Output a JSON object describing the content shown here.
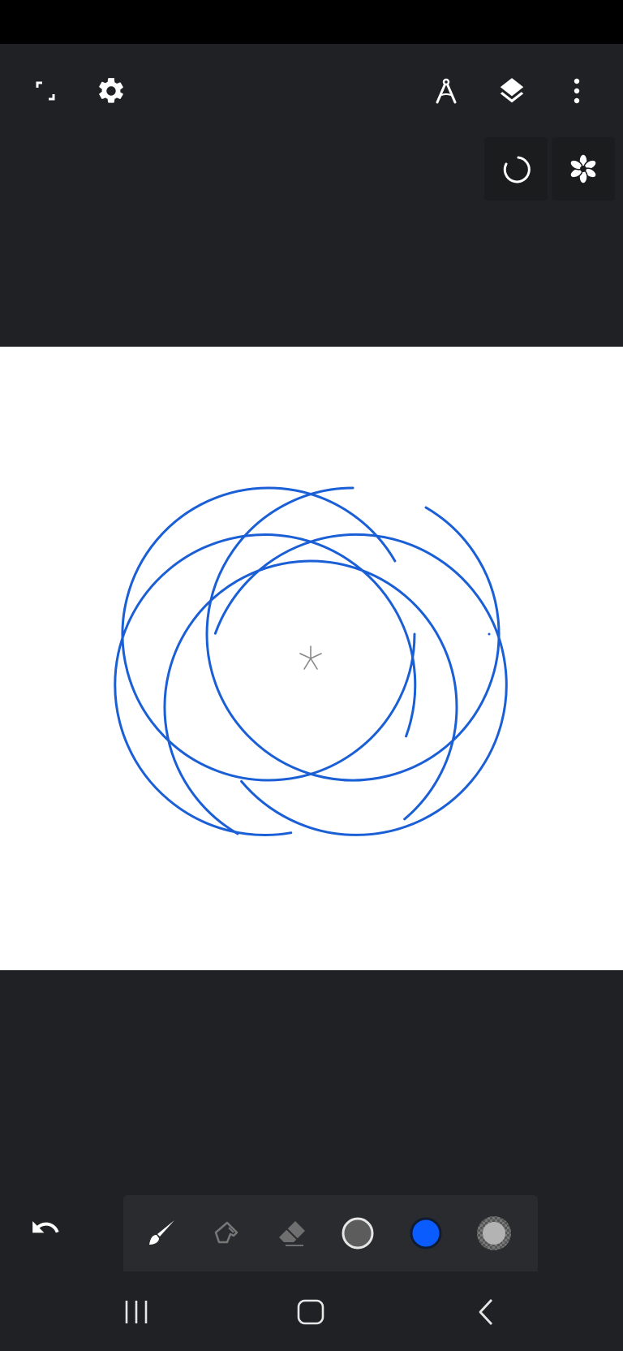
{
  "colors": {
    "background": "#202124",
    "status_bar": "#000000",
    "canvas": "#ffffff",
    "stroke": "#1a5fd6",
    "active_color": "#0a5cff",
    "toolbar": "#2a2b2e"
  },
  "top_bar": {
    "left_icons": [
      "fullscreen-icon",
      "settings-icon"
    ],
    "right_icons": [
      "compass-icon",
      "layers-icon",
      "more-vert-icon"
    ]
  },
  "tool_panel": {
    "buttons": [
      "rotate-icon",
      "flower-symmetry-icon"
    ]
  },
  "canvas": {
    "center_marker": "asterisk-icon",
    "drawing": "spirograph-of-blue-arcs"
  },
  "bottom_toolbar": {
    "undo": "undo-icon",
    "tools": [
      "brush-icon",
      "smudge-icon",
      "eraser-icon",
      "brush-size-icon",
      "color-swatch-icon",
      "opacity-icon"
    ],
    "selected_color": "#0a5cff"
  },
  "nav_bar": {
    "buttons": [
      "recent-apps-icon",
      "home-icon",
      "back-icon"
    ]
  }
}
